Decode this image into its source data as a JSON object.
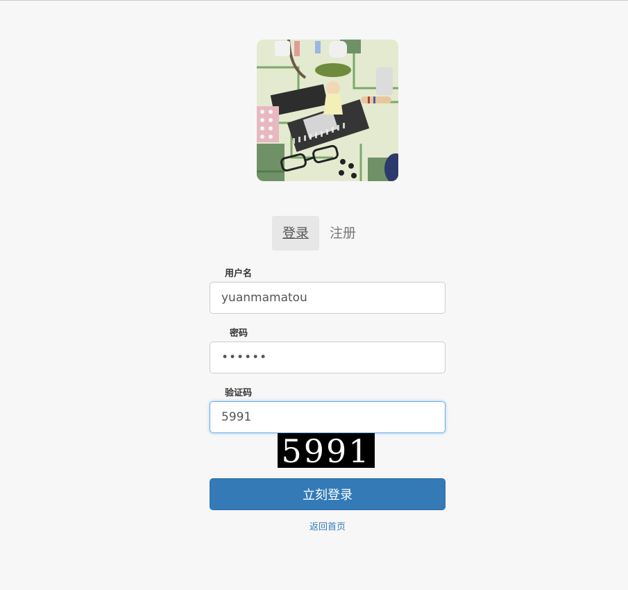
{
  "tabs": [
    {
      "label": "登录",
      "active": true
    },
    {
      "label": "注册",
      "active": false
    }
  ],
  "form": {
    "username": {
      "label": "用户名",
      "value": "yuanmamatou"
    },
    "password": {
      "label": "密码",
      "value": "••••••"
    },
    "captcha": {
      "label": "验证码",
      "value": "5991"
    },
    "captcha_image_text": "5991",
    "submit_label": "立刻登录",
    "home_link": "返回首页"
  },
  "colors": {
    "primary": "#337ab7",
    "focus_border": "#66afe9",
    "background": "#f7f7f8"
  }
}
